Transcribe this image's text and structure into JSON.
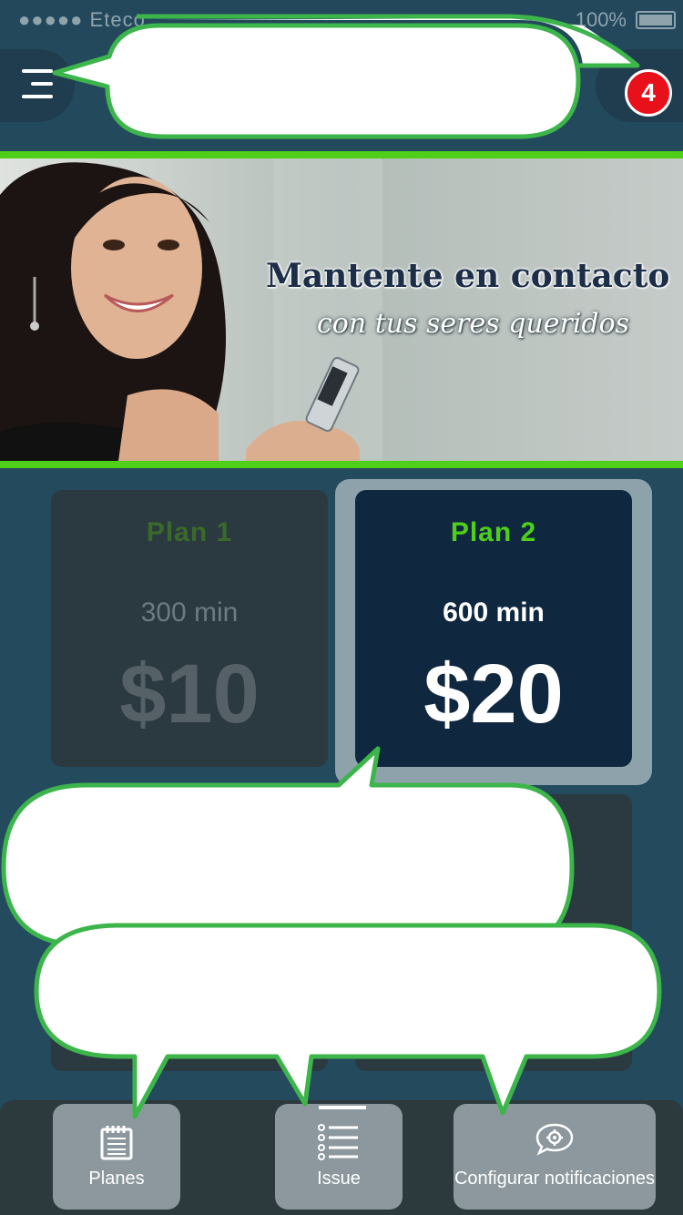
{
  "status_bar": {
    "carrier": "●●●●● Eteco",
    "battery_percent": "100%"
  },
  "header": {
    "menu_icon": "hamburger-icon",
    "notification_count": "4"
  },
  "banner": {
    "title": "Mantente en contacto",
    "subtitle": "con tus seres queridos"
  },
  "plans": [
    {
      "name": "Plan 1",
      "minutes": "300 min",
      "price": "$10",
      "selected": false
    },
    {
      "name": "Plan 2",
      "minutes": "600 min",
      "price": "$20",
      "selected": true
    }
  ],
  "tab_bar": {
    "tabs": [
      {
        "label": "Planes",
        "icon": "calendar-list-icon"
      },
      {
        "label": "Issue",
        "icon": "list-icon",
        "active": true
      },
      {
        "label": "Configurar notificaciones",
        "icon": "chat-gear-icon"
      }
    ]
  },
  "colors": {
    "accent_green": "#4fcf1a",
    "background": "#244a5e",
    "badge_red": "#e8101a",
    "selected_plan": "#0f2840"
  }
}
